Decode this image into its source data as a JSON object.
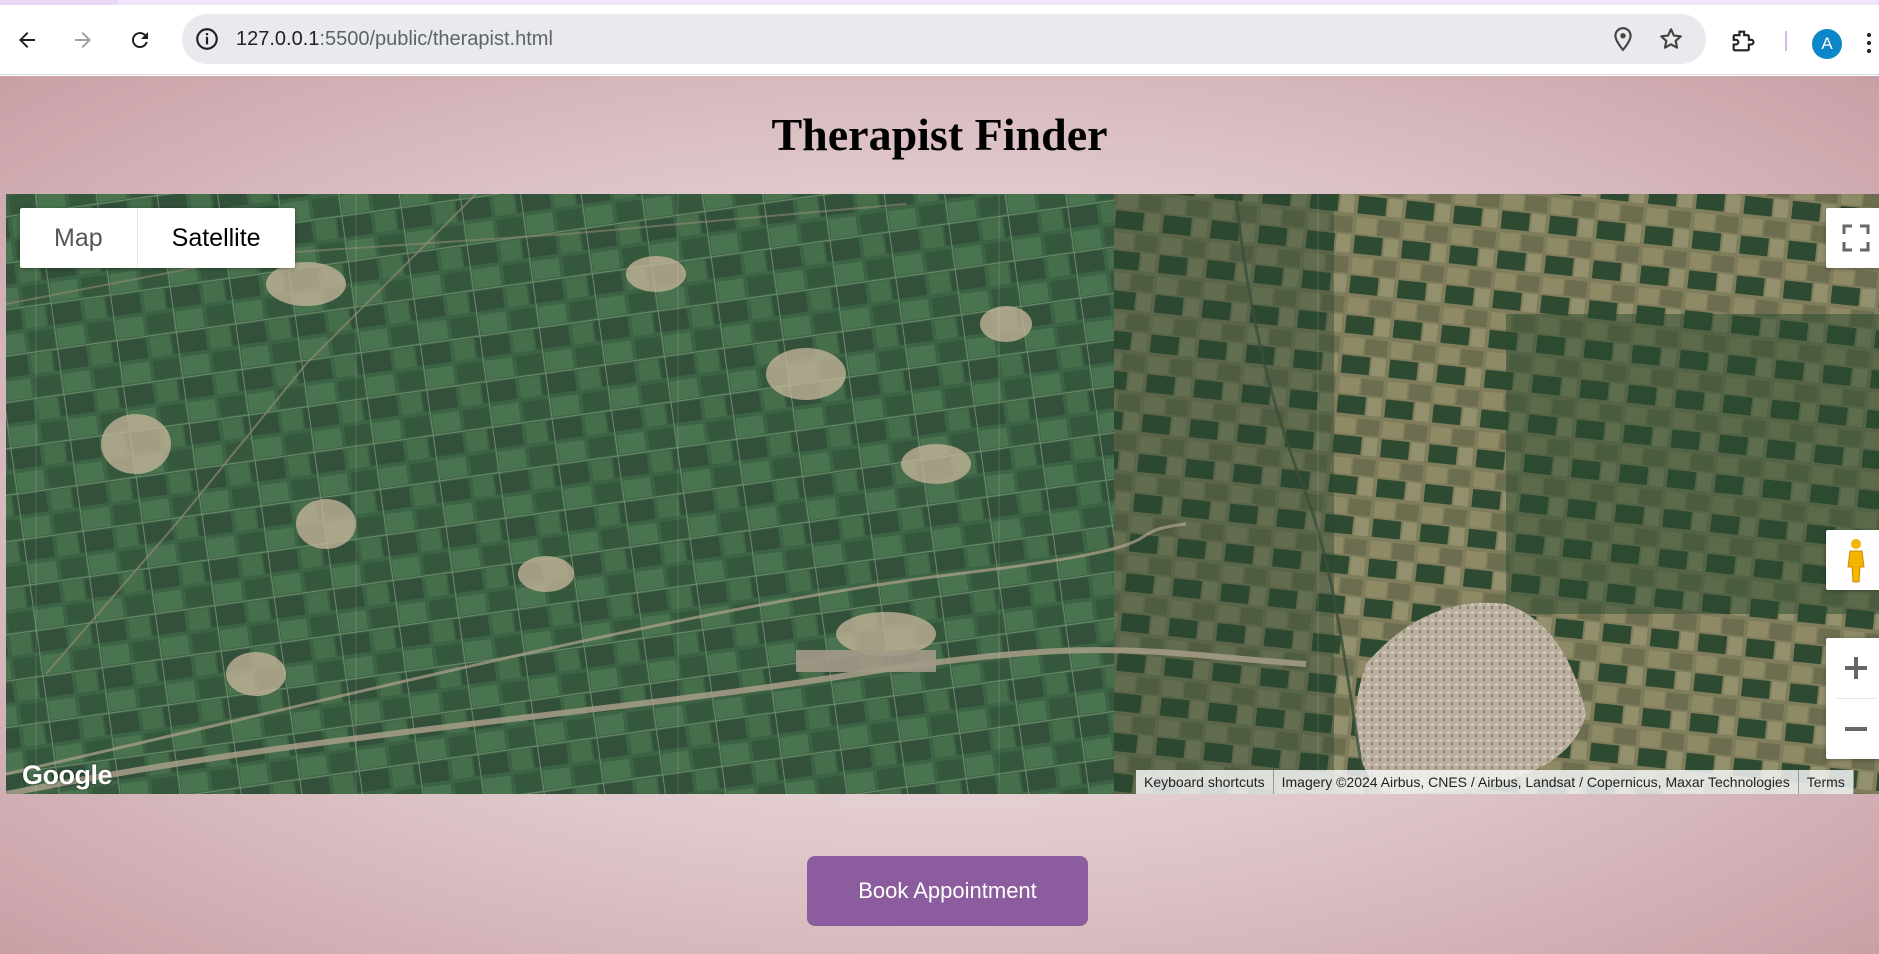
{
  "browser": {
    "url_host": "127.0.0.1",
    "url_rest": ":5500/public/therapist.html",
    "profile_initial": "A"
  },
  "page": {
    "title": "Therapist Finder"
  },
  "map": {
    "type_options": [
      "Map",
      "Satellite"
    ],
    "selected_type": "Satellite",
    "logo_text": "Google",
    "attribution": {
      "shortcuts": "Keyboard shortcuts",
      "imagery": "Imagery ©2024 Airbus, CNES / Airbus, Landsat / Copernicus, Maxar Technologies",
      "terms": "Terms"
    },
    "colors": {
      "vegetation": "#3f6647",
      "fields_dry": "#8c8a68",
      "town": "#b8ab9c"
    }
  },
  "actions": {
    "book_label": "Book Appointment"
  },
  "colors": {
    "accent": "#8b5c9e",
    "page_bg_center": "#f3e6e8",
    "page_bg_edge": "#c8a0a6"
  }
}
